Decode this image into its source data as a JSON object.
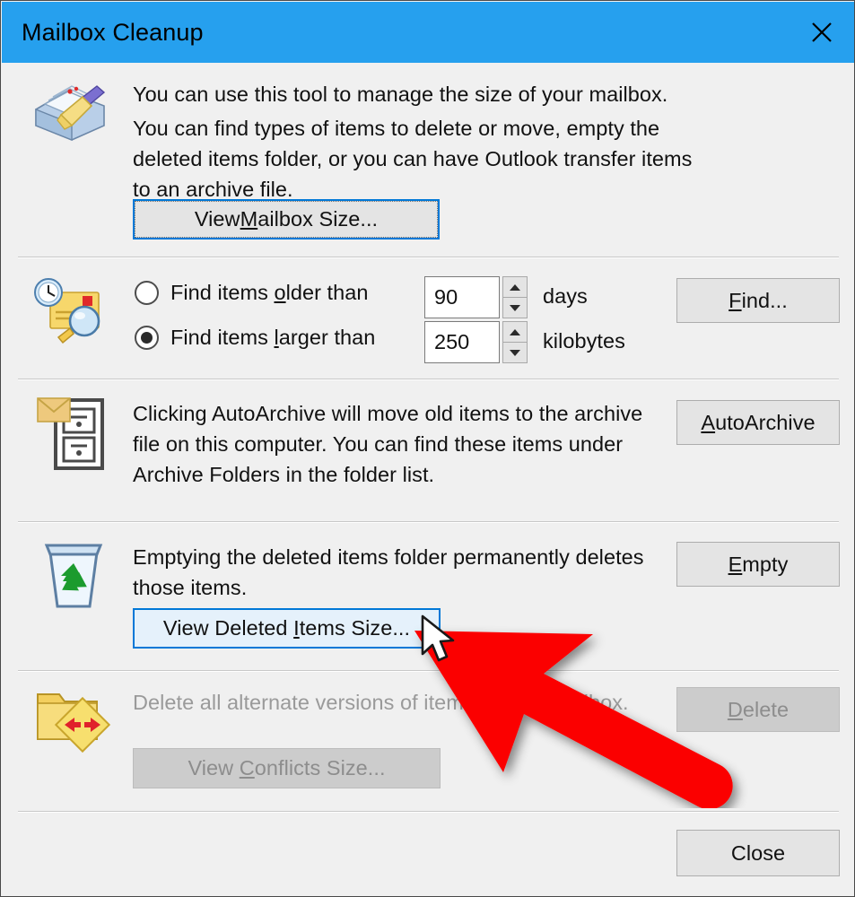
{
  "window": {
    "title": "Mailbox Cleanup",
    "close_icon": "close-icon",
    "titlebar_color": "#26a0ee"
  },
  "sections": {
    "intro": {
      "icon": "mailbox-cleanup-icon",
      "text_line1": "You can use this tool to manage the size of your mailbox.",
      "text_line2": "You can find types of items to delete or move, empty the deleted items folder, or you can have Outlook transfer items to an archive file.",
      "button": {
        "label_pre": "View ",
        "label_acc": "M",
        "label_post": "ailbox Size...",
        "full_label": "View Mailbox Size...",
        "state": "focused"
      }
    },
    "find": {
      "icon": "find-items-icon",
      "radio_older": {
        "label_pre": "Find items ",
        "label_acc": "o",
        "label_post": "lder than",
        "full_label": "Find items older than",
        "selected": false,
        "value": "90",
        "unit": "days"
      },
      "radio_larger": {
        "label_pre": "Find items ",
        "label_acc": "l",
        "label_post": "arger than",
        "full_label": "Find items larger than",
        "selected": true,
        "value": "250",
        "unit": "kilobytes"
      },
      "button": {
        "label_acc": "F",
        "label_post": "ind...",
        "full_label": "Find..."
      }
    },
    "autoarchive": {
      "icon": "file-cabinet-icon",
      "text": "Clicking AutoArchive will move old items to the archive file on this computer. You can find these items under Archive Folders in the folder list.",
      "button": {
        "label_acc": "A",
        "label_post": "utoArchive",
        "full_label": "AutoArchive"
      }
    },
    "deleted": {
      "icon": "recycle-bin-icon",
      "text": "Emptying the deleted items folder permanently deletes those items.",
      "button_view": {
        "label_pre": "View Deleted ",
        "label_acc": "I",
        "label_post": "tems Size...",
        "full_label": "View Deleted Items Size...",
        "state": "hovered"
      },
      "button_empty": {
        "label_acc": "E",
        "label_post": "mpty",
        "full_label": "Empty"
      }
    },
    "conflicts": {
      "icon": "conflicts-folder-icon",
      "text": "Delete all alternate versions of items in your mailbox.",
      "disabled": true,
      "button_view": {
        "label_pre": "View ",
        "label_acc": "C",
        "label_post": "onflicts Size...",
        "full_label": "View Conflicts Size...",
        "disabled": true
      },
      "button_delete": {
        "label_acc": "D",
        "label_post": "elete",
        "full_label": "Delete",
        "disabled": true
      }
    }
  },
  "footer": {
    "close_button": "Close"
  },
  "annotation": {
    "arrow_color": "#fb0000",
    "cursor": "mouse-pointer"
  }
}
